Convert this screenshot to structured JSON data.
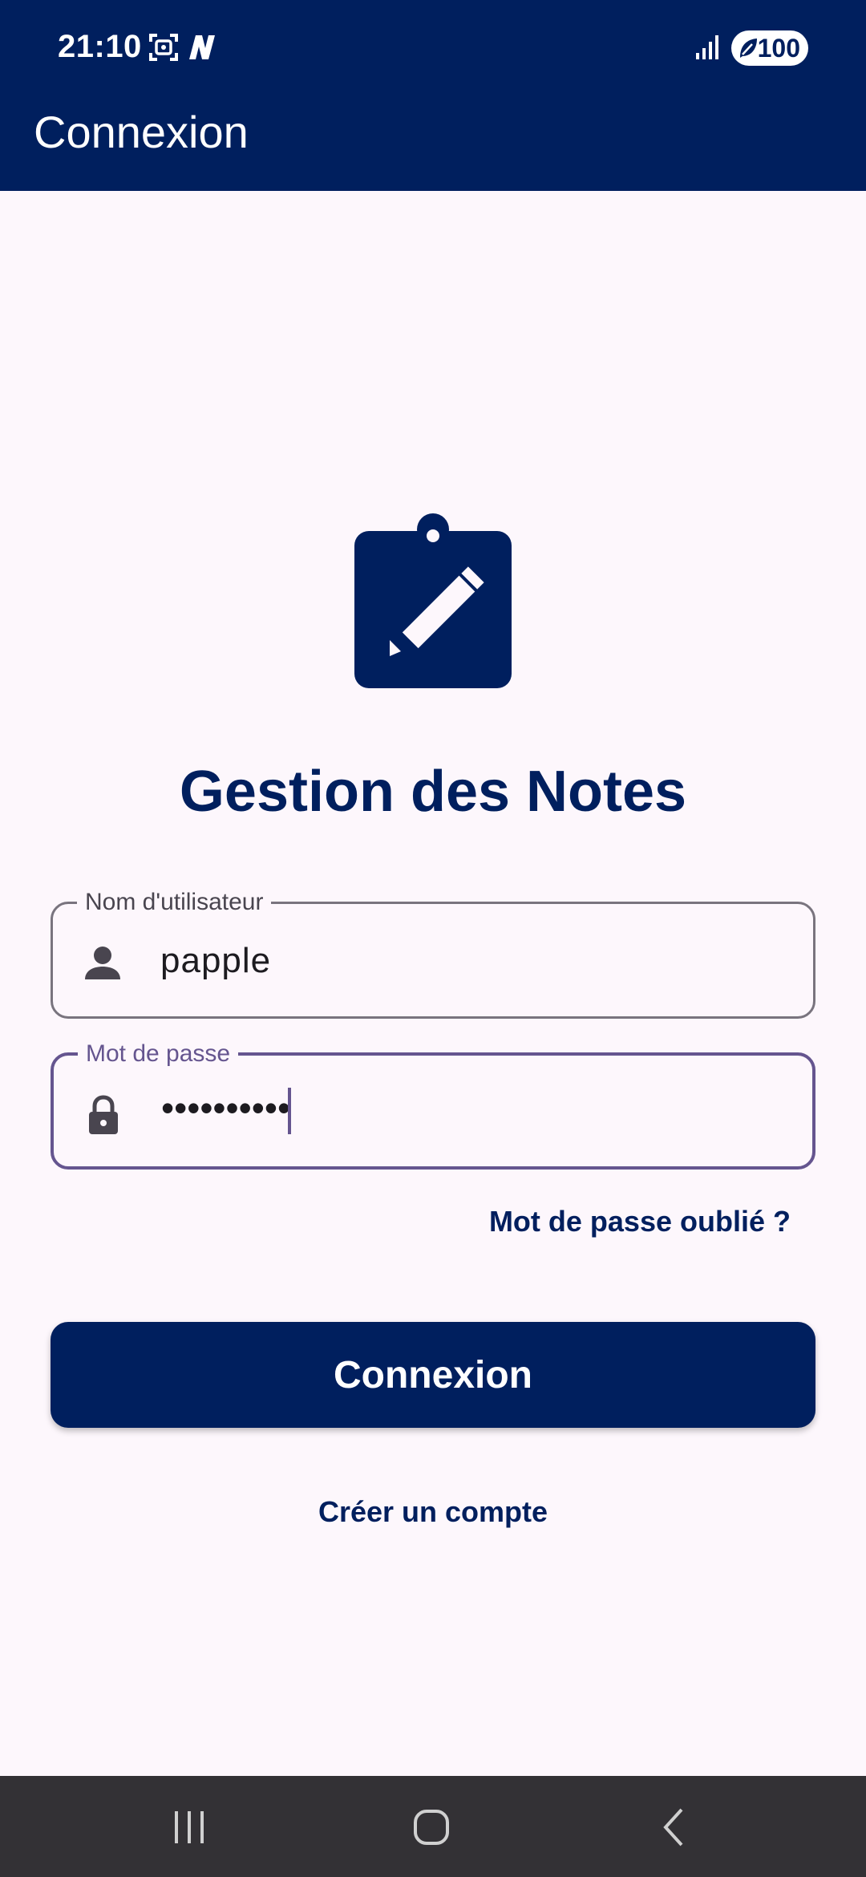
{
  "status_bar": {
    "time": "21:10",
    "battery": "100"
  },
  "app_bar": {
    "title": "Connexion"
  },
  "logo": {
    "icon": "clipboard-edit-icon"
  },
  "app_title": "Gestion des Notes",
  "username_field": {
    "label": "Nom d'utilisateur",
    "value": "papple",
    "icon": "person-icon"
  },
  "password_field": {
    "label": "Mot de passe",
    "value": "••••••••••",
    "icon": "lock-icon",
    "focused": true
  },
  "forgot_password": "Mot de passe oublié ?",
  "login_button": "Connexion",
  "create_account": "Créer un compte",
  "colors": {
    "primary": "#001f5e",
    "focus": "#65558f",
    "background": "#fdf7fc"
  },
  "nav_bar": {
    "icons": [
      "recents-icon",
      "home-icon",
      "back-icon"
    ]
  }
}
